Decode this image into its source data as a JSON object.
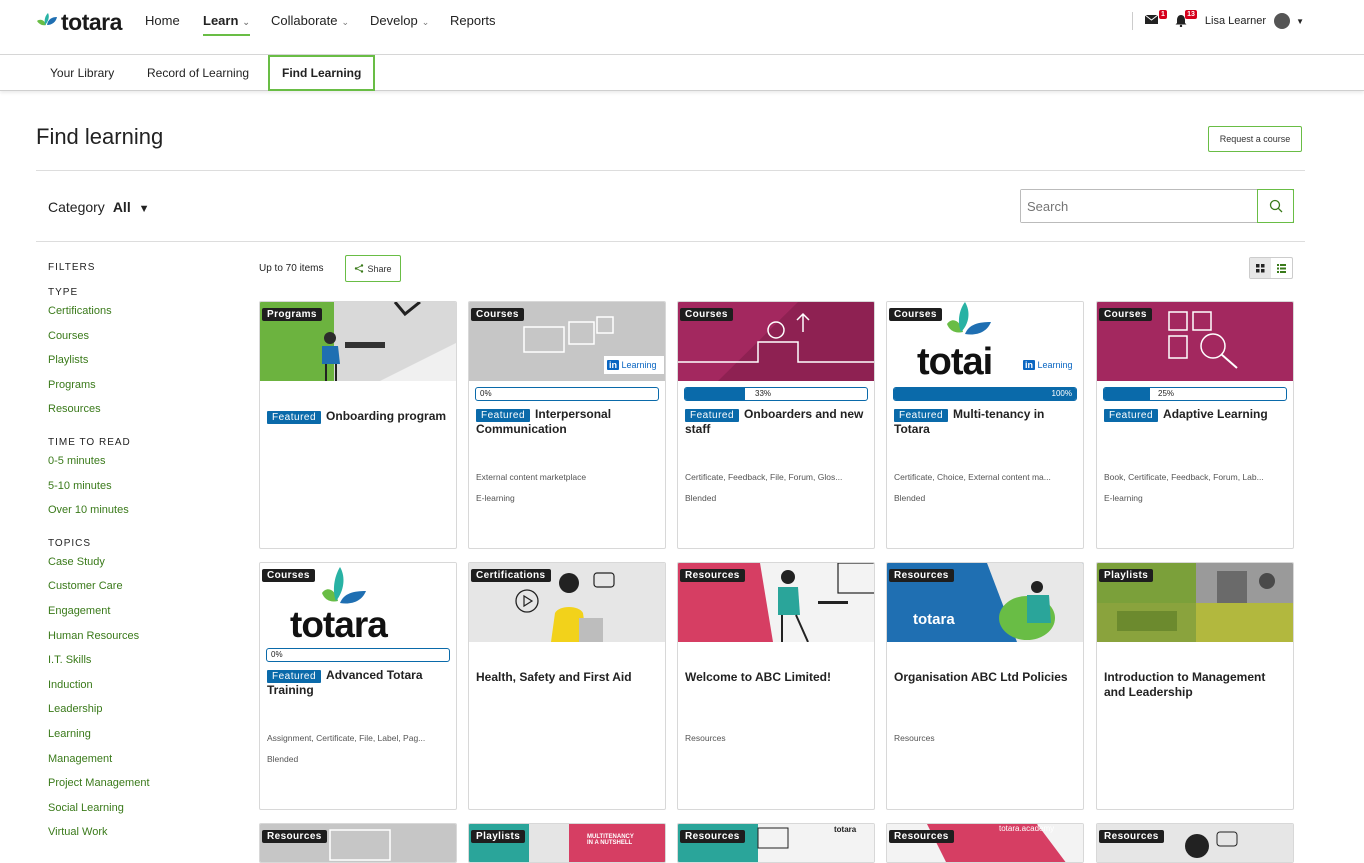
{
  "brand": {
    "name": "totara",
    "color": "#69bd45"
  },
  "nav": {
    "home": "Home",
    "learn": "Learn",
    "collaborate": "Collaborate",
    "develop": "Develop",
    "reports": "Reports"
  },
  "user": {
    "name": "Lisa Learner",
    "messages_count": "1",
    "notifications_count": "13"
  },
  "subnav": {
    "library": "Your Library",
    "record": "Record of Learning",
    "find": "Find Learning"
  },
  "page": {
    "title": "Find learning",
    "request_button": "Request a course"
  },
  "category": {
    "label": "Category",
    "value": "All"
  },
  "search": {
    "placeholder": "Search"
  },
  "results": {
    "count_text": "Up to 70 items",
    "share_label": "Share"
  },
  "filters": {
    "heading": "FILTERS",
    "groups": [
      {
        "title": "TYPE",
        "items": [
          "Certifications",
          "Courses",
          "Playlists",
          "Programs",
          "Resources"
        ]
      },
      {
        "title": "TIME TO READ",
        "items": [
          "0-5 minutes",
          "5-10 minutes",
          "Over 10 minutes"
        ]
      },
      {
        "title": "TOPICS",
        "items": [
          "Case Study",
          "Customer Care",
          "Engagement",
          "Human Resources",
          "I.T. Skills",
          "Induction",
          "Leadership",
          "Learning",
          "Management",
          "Project Management",
          "Social Learning",
          "Virtual Work"
        ]
      }
    ]
  },
  "featured_label": "Featured",
  "cards": [
    {
      "type": "Programs",
      "featured": true,
      "title": "Onboarding program",
      "progress": null,
      "meta1": "",
      "meta2": ""
    },
    {
      "type": "Courses",
      "featured": true,
      "title": "Interpersonal Communication",
      "progress": "0%",
      "progress_value": 0,
      "meta1": "External content marketplace",
      "meta2": "E-learning"
    },
    {
      "type": "Courses",
      "featured": true,
      "title": "Onboarders and new staff",
      "progress": "33%",
      "progress_value": 33,
      "meta1": "Certificate, Feedback, File, Forum, Glos...",
      "meta2": "Blended"
    },
    {
      "type": "Courses",
      "featured": true,
      "title": "Multi-tenancy in Totara",
      "progress": "100%",
      "progress_value": 100,
      "meta1": "Certificate, Choice, External content ma...",
      "meta2": "Blended"
    },
    {
      "type": "Courses",
      "featured": true,
      "title": "Adaptive Learning",
      "progress": "25%",
      "progress_value": 25,
      "meta1": "Book, Certificate, Feedback, Forum, Lab...",
      "meta2": "E-learning"
    },
    {
      "type": "Courses",
      "featured": true,
      "title": "Advanced Totara Training",
      "progress": "0%",
      "progress_value": 0,
      "meta1": "Assignment, Certificate, File, Label, Pag...",
      "meta2": "Blended"
    },
    {
      "type": "Certifications",
      "featured": false,
      "title": "Health, Safety and First Aid",
      "progress": null,
      "meta1": "",
      "meta2": ""
    },
    {
      "type": "Resources",
      "featured": false,
      "title": "Welcome to ABC Limited!",
      "progress": null,
      "meta1": "Resources",
      "meta2": ""
    },
    {
      "type": "Resources",
      "featured": false,
      "title": "Organisation ABC Ltd Policies",
      "progress": null,
      "meta1": "Resources",
      "meta2": ""
    },
    {
      "type": "Playlists",
      "featured": false,
      "title": "Introduction to Management and Leadership",
      "progress": null,
      "meta1": "",
      "meta2": ""
    },
    {
      "type": "Resources"
    },
    {
      "type": "Playlists"
    },
    {
      "type": "Resources"
    },
    {
      "type": "Resources"
    },
    {
      "type": "Resources"
    }
  ],
  "thumb_text": {
    "linkedin": "Learning",
    "li": "in",
    "totara_logo": "totara",
    "totai": "totai",
    "multitenancy": "MULTITENANCY IN A NUTSHELL",
    "academy": "totara.academy"
  }
}
